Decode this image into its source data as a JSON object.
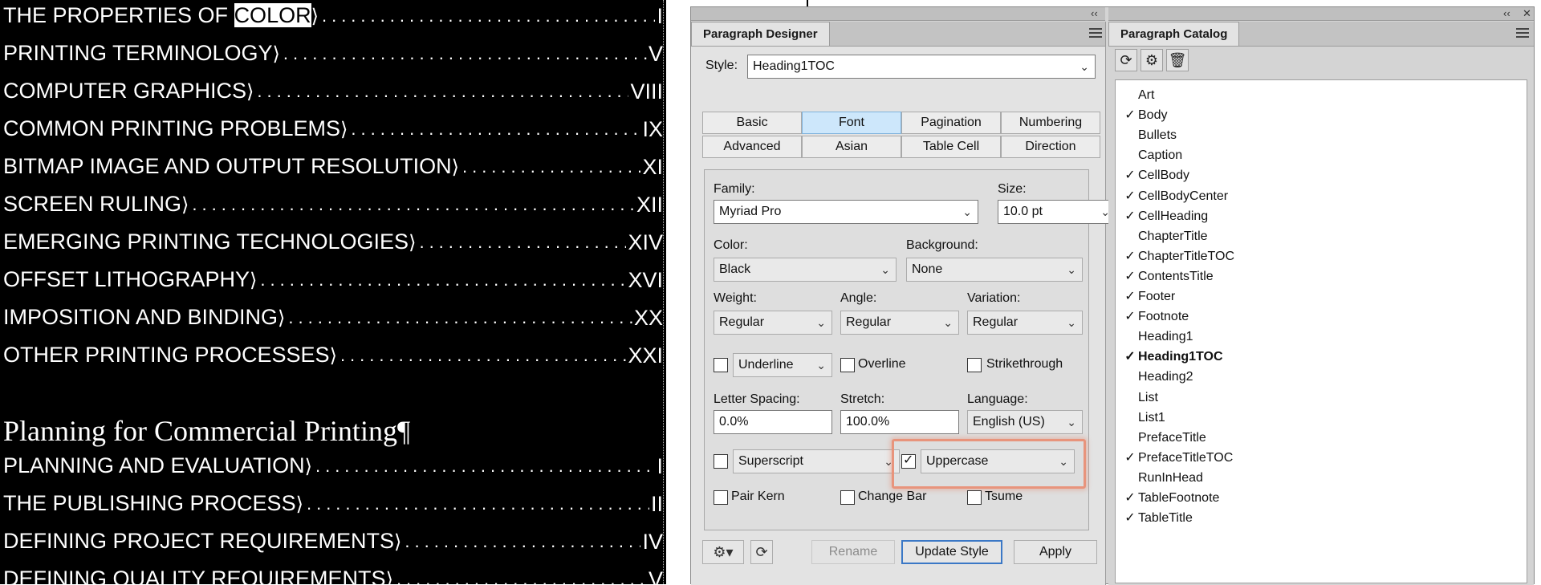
{
  "toc": {
    "rows_part1": [
      {
        "title": "THE PROPERTIES OF ",
        "title_highlight": "COLOR",
        "page": "I"
      },
      {
        "title": "PRINTING TERMINOLOGY",
        "page": "V"
      },
      {
        "title": "COMPUTER GRAPHICS",
        "page": "VIII"
      },
      {
        "title": "COMMON PRINTING PROBLEMS",
        "page": "IX"
      },
      {
        "title": "BITMAP IMAGE AND OUTPUT RESOLUTION",
        "page": "XI"
      },
      {
        "title": "SCREEN RULING",
        "page": "XII"
      },
      {
        "title": "EMERGING PRINTING TECHNOLOGIES",
        "page": "XIV"
      },
      {
        "title": "OFFSET LITHOGRAPHY",
        "page": "XVI"
      },
      {
        "title": "IMPOSITION AND BINDING",
        "page": "XX"
      },
      {
        "title": "OTHER PRINTING PROCESSES",
        "page": "XXI"
      }
    ],
    "section_heading": "Planning for Commercial Printing¶",
    "rows_part2": [
      {
        "title": "PLANNING AND EVALUATION",
        "page": "I"
      },
      {
        "title": "THE PUBLISHING PROCESS",
        "page": "II"
      },
      {
        "title": "DEFINING PROJECT REQUIREMENTS",
        "page": "IV"
      },
      {
        "title": "DEFINING QUALITY REQUIREMENTS",
        "page": "V"
      }
    ],
    "tab_marker": "⟩",
    "leader": "................................................................................................"
  },
  "panel_strip": {
    "collapse_left": "‹‹",
    "collapse_right": "‹‹",
    "close": "✕"
  },
  "paragraph_designer": {
    "title": "Paragraph Designer",
    "style_label": "Style:",
    "style_value": "Heading1TOC",
    "tabs_row1": [
      "Basic",
      "Font",
      "Pagination",
      "Numbering"
    ],
    "tabs_row2": [
      "Advanced",
      "Asian",
      "Table Cell",
      "Direction"
    ],
    "active_tab": "Font",
    "family_label": "Family:",
    "family_value": "Myriad Pro",
    "size_label": "Size:",
    "size_value": "10.0 pt",
    "color_label": "Color:",
    "color_value": "Black",
    "background_label": "Background:",
    "background_value": "None",
    "weight_label": "Weight:",
    "weight_value": "Regular",
    "angle_label": "Angle:",
    "angle_value": "Regular",
    "variation_label": "Variation:",
    "variation_value": "Regular",
    "underline_value": "Underline",
    "overline_label": "Overline",
    "strikethrough_label": "Strikethrough",
    "letter_spacing_label": "Letter Spacing:",
    "letter_spacing_value": "0.0%",
    "stretch_label": "Stretch:",
    "stretch_value": "100.0%",
    "language_label": "Language:",
    "language_value": "English (US)",
    "superscript_value": "Superscript",
    "uppercase_value": "Uppercase",
    "uppercase_checked": true,
    "pair_kern_label": "Pair Kern",
    "change_bar_label": "Change Bar",
    "tsume_label": "Tsume",
    "rename_label": "Rename",
    "update_style_label": "Update Style",
    "apply_label": "Apply",
    "gear_icon": "gear-icon",
    "refresh_icon": "refresh-icon"
  },
  "paragraph_catalog": {
    "title": "Paragraph Catalog",
    "items": [
      {
        "name": "Art",
        "checked": false
      },
      {
        "name": "Body",
        "checked": true
      },
      {
        "name": "Bullets",
        "checked": false
      },
      {
        "name": "Caption",
        "checked": false
      },
      {
        "name": "CellBody",
        "checked": true
      },
      {
        "name": "CellBodyCenter",
        "checked": true
      },
      {
        "name": "CellHeading",
        "checked": true
      },
      {
        "name": "ChapterTitle",
        "checked": false
      },
      {
        "name": "ChapterTitleTOC",
        "checked": true
      },
      {
        "name": "ContentsTitle",
        "checked": true
      },
      {
        "name": "Footer",
        "checked": true
      },
      {
        "name": "Footnote",
        "checked": true
      },
      {
        "name": "Heading1",
        "checked": false
      },
      {
        "name": "Heading1TOC",
        "checked": true,
        "current": true
      },
      {
        "name": "Heading2",
        "checked": false
      },
      {
        "name": "List",
        "checked": false
      },
      {
        "name": "List1",
        "checked": false
      },
      {
        "name": "PrefaceTitle",
        "checked": false
      },
      {
        "name": "PrefaceTitleTOC",
        "checked": true
      },
      {
        "name": "RunInHead",
        "checked": false
      },
      {
        "name": "TableFootnote",
        "checked": true
      },
      {
        "name": "TableTitle",
        "checked": true
      }
    ],
    "check_mark": "✓"
  },
  "colors": {
    "accent_highlight": "#e8947c",
    "active_tab": "#cde7fb",
    "document_bg": "#000000"
  }
}
